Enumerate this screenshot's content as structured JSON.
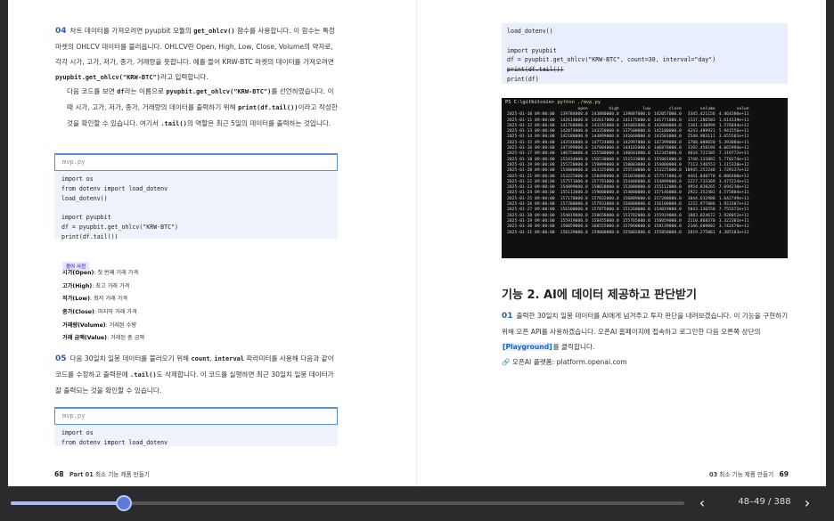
{
  "left": {
    "step04": {
      "num": "04",
      "p1_parts": [
        "차트 데이터를 가져오려면 pyupbit 모듈의 ",
        "get_ohlcv()",
        " 함수를 사용합니다. 이 함수는 특정 마켓의 OHLCV 데이터를 불러옵니다. OHLCV란 Open, High, Low, Close, Volume의 약자로, 각각 시가, 고가, 저가, 종가, 거래량을 뜻합니다. 예를 들어 KRW-BTC 마켓의 데이터를 가져오려면 ",
        "pyupbit.get_ohlcv(\"KRW-BTC\")",
        "라고 입력합니다."
      ],
      "p2_parts": [
        "다음 코드를 보면 ",
        "df",
        "라는 이름으로 ",
        "pyupbit.get_ohlcv(\"KRW-BTC\")",
        "를 선언하였습니다. 이때 시가, 고가, 저가, 종가, 거래량의 데이터를 출력하기 위해 ",
        "print(df.tail())",
        "이라고 작성한 것을 확인할 수 있습니다. 여기서 ",
        ".tail()",
        "의 역할은 최근 5일의 데이터를 출력하는 것입니다."
      ]
    },
    "code1": {
      "file": "mvp.py",
      "lines": [
        "import os",
        "from dotenv import load_dotenv",
        "load_dotenv()",
        "",
        "import pyupbit",
        "df = pyupbit.get_ohlcv(\"KRW-BTC\")",
        "print(df.tail())"
      ]
    },
    "tip": {
      "badge": "용어 사전",
      "items": [
        {
          "term": "시가(Open)",
          "desc": ": 첫 번째 거래 가격"
        },
        {
          "term": "고가(High)",
          "desc": ": 최고 거래 가격"
        },
        {
          "term": "저가(Low)",
          "desc": ": 최저 거래 가격"
        },
        {
          "term": "종가(Close)",
          "desc": ": 마지막 거래 가격"
        },
        {
          "term": "거래량(Volume)",
          "desc": ": 거래된 수량"
        },
        {
          "term": "거래 금액(Value)",
          "desc": ": 거래된 총 금액"
        }
      ]
    },
    "step05": {
      "num": "05",
      "parts": [
        "다음 30일치 일봉 데이터를 불러오기 위해 ",
        "count",
        ", ",
        "interval",
        " 파라미터를 사용해 다음과 같이 코드를 수정하고 출력문에 ",
        ".tail()",
        "도 삭제합니다. 이 코드를 실행하면 최근 30일치 일봉 데이터가 잘 출력되는 것을 확인할 수 있습니다."
      ]
    },
    "code2": {
      "file": "mvp.py",
      "lines": [
        "import os",
        "from dotenv import load_dotenv"
      ]
    },
    "footer": {
      "page": "68",
      "part": "Part 01",
      "title": "최소 기능 제품 만들기"
    }
  },
  "right": {
    "code": {
      "lines": [
        "load_dotenv()",
        "",
        "import pyupbit",
        "df = pyupbit.get_ohlcv(\"KRW-BTC\", count=30, interval=\"day\")"
      ],
      "strike": "print(df.tail())",
      "last": "print(df)"
    },
    "terminal": {
      "prompt": "PS C:\\gitbitcoin>",
      "cmd": "python ./mvp.py",
      "headers": [
        "",
        "open",
        "high",
        "low",
        "close",
        "volume",
        "value"
      ],
      "rows": [
        [
          "2025-01-10 09:00:00",
          "139784000.0",
          "143880000.0",
          "139887000.0",
          "142057000.0",
          "3345.421156",
          "4.464380e+11"
        ],
        [
          "2025-01-11 09:00:00",
          "142614000.0",
          "142617000.0",
          "141175000.0",
          "141771000.0",
          "1137.286503",
          "1.614139e+11"
        ],
        [
          "2025-01-12 09:00:00",
          "141768000.0",
          "143245000.0",
          "141002000.0",
          "142000000.0",
          "1101.130999",
          "1.576844e+11"
        ],
        [
          "2025-01-13 09:00:00",
          "142074000.0",
          "143350000.0",
          "137500000.0",
          "142180000.0",
          "4243.489921",
          "5.941556e+11"
        ],
        [
          "2025-01-14 09:00:00",
          "142180000.0",
          "144899000.0",
          "141660000.0",
          "143501000.0",
          "2540.983111",
          "3.655501e+11"
        ],
        [
          "2025-01-15 09:00:00",
          "143546000.0",
          "147724000.0",
          "142997000.0",
          "147399000.0",
          "3708.088650",
          "5.393084e+11"
        ],
        [
          "2025-01-16 09:00:00",
          "147399000.0",
          "147804000.0",
          "144102000.0",
          "146870000.0",
          "3192.458194",
          "4.665994e+11"
        ],
        [
          "2025-01-17 09:00:00",
          "146750000.0",
          "155500000.0",
          "146601000.0",
          "152345000.0",
          "4834.721505",
          "7.319772e+11"
        ],
        [
          "2025-01-18 09:00:00",
          "152434000.0",
          "156530000.0",
          "151533000.0",
          "155001000.0",
          "3748.133882",
          "5.770274e+11"
        ],
        [
          "2025-01-19 09:00:00",
          "155720000.0",
          "159099000.0",
          "150003000.0",
          "154000000.0",
          "7113.546553",
          "1.115328e+12"
        ],
        [
          "2025-01-20 09:00:00",
          "154000000.0",
          "163325000.0",
          "155510000.0",
          "153225000.0",
          "10945.252248",
          "1.729137e+12"
        ],
        [
          "2025-01-21 09:00:00",
          "153225000.0",
          "158490000.0",
          "151030000.0",
          "157571000.0",
          "4441.840770",
          "6.886400e+11"
        ],
        [
          "2025-01-22 09:00:00",
          "157571000.0",
          "157791000.0",
          "154486000.0",
          "154899000.0",
          "2227.733369",
          "3.477224e+11"
        ],
        [
          "2025-01-23 09:00:00",
          "154899000.0",
          "158028000.0",
          "152080000.0",
          "155112000.0",
          "4954.838265",
          "7.694230e+11"
        ],
        [
          "2025-01-24 09:00:00",
          "155112000.0",
          "159000000.0",
          "154000000.0",
          "157146000.0",
          "2922.352401",
          "4.575804e+11"
        ],
        [
          "2025-01-25 09:00:00",
          "157170000.0",
          "157832000.0",
          "156889000.0",
          "157200000.0",
          "1044.632980",
          "1.642749e+11"
        ],
        [
          "2025-01-26 09:00:00",
          "157200000.0",
          "157933000.0",
          "156000000.0",
          "156100000.0",
          "1222.977086",
          "1.922307e+11"
        ],
        [
          "2025-01-27 09:00:00",
          "156100000.0",
          "157875000.0",
          "151260000.0",
          "154019000.0",
          "5043.136550",
          "7.755371e+11"
        ],
        [
          "2025-01-28 09:00:00",
          "154019000.0",
          "158658000.0",
          "153782000.0",
          "155919000.0",
          "1883.824672",
          "2.928052e+11"
        ],
        [
          "2025-01-29 09:00:00",
          "155919000.0",
          "158455000.0",
          "155765000.0",
          "158059000.0",
          "2110.868370",
          "3.322301e+11"
        ],
        [
          "2025-01-30 09:00:00",
          "158059000.0",
          "160555000.0",
          "157060000.0",
          "158139000.0",
          "2346.609002",
          "3.742470e+11"
        ],
        [
          "2025-01-31 09:00:00",
          "158139000.0",
          "159000000.0",
          "155002000.0",
          "155050000.0",
          "2819.275061",
          "4.385183e+11"
        ]
      ]
    },
    "section_title": "기능 2. AI에 데이터 제공하고 판단받기",
    "step01": {
      "num": "01",
      "parts": [
        "출력한 30일치 일봉 데이터를 AI에게 넘겨주고 투자 판단을 내려보겠습니다. 이 기능을 구현하기 위해 오픈 API를 사용하겠습니다. 오픈AI 홈페이지에 접속하고 로그인한 다음 오른쪽 상단의 ",
        "[Playground]",
        "를 클릭합니다."
      ]
    },
    "link": {
      "label": "오픈AI 플랫폼:",
      "url": "platform.openai.com"
    },
    "footer": {
      "chapter": "03",
      "title": "최소 기능 제품 만들기",
      "page": "69"
    }
  },
  "reader": {
    "progress": 0.168,
    "page_indicator": "48–49 / 388",
    "prev_icon": "chevron-left-icon",
    "next_icon": "chevron-right-icon",
    "colors": {
      "track": "#555555",
      "fill": "#aab8ff",
      "knob": "#5c7bd9",
      "accent": "#1a63c9"
    }
  }
}
